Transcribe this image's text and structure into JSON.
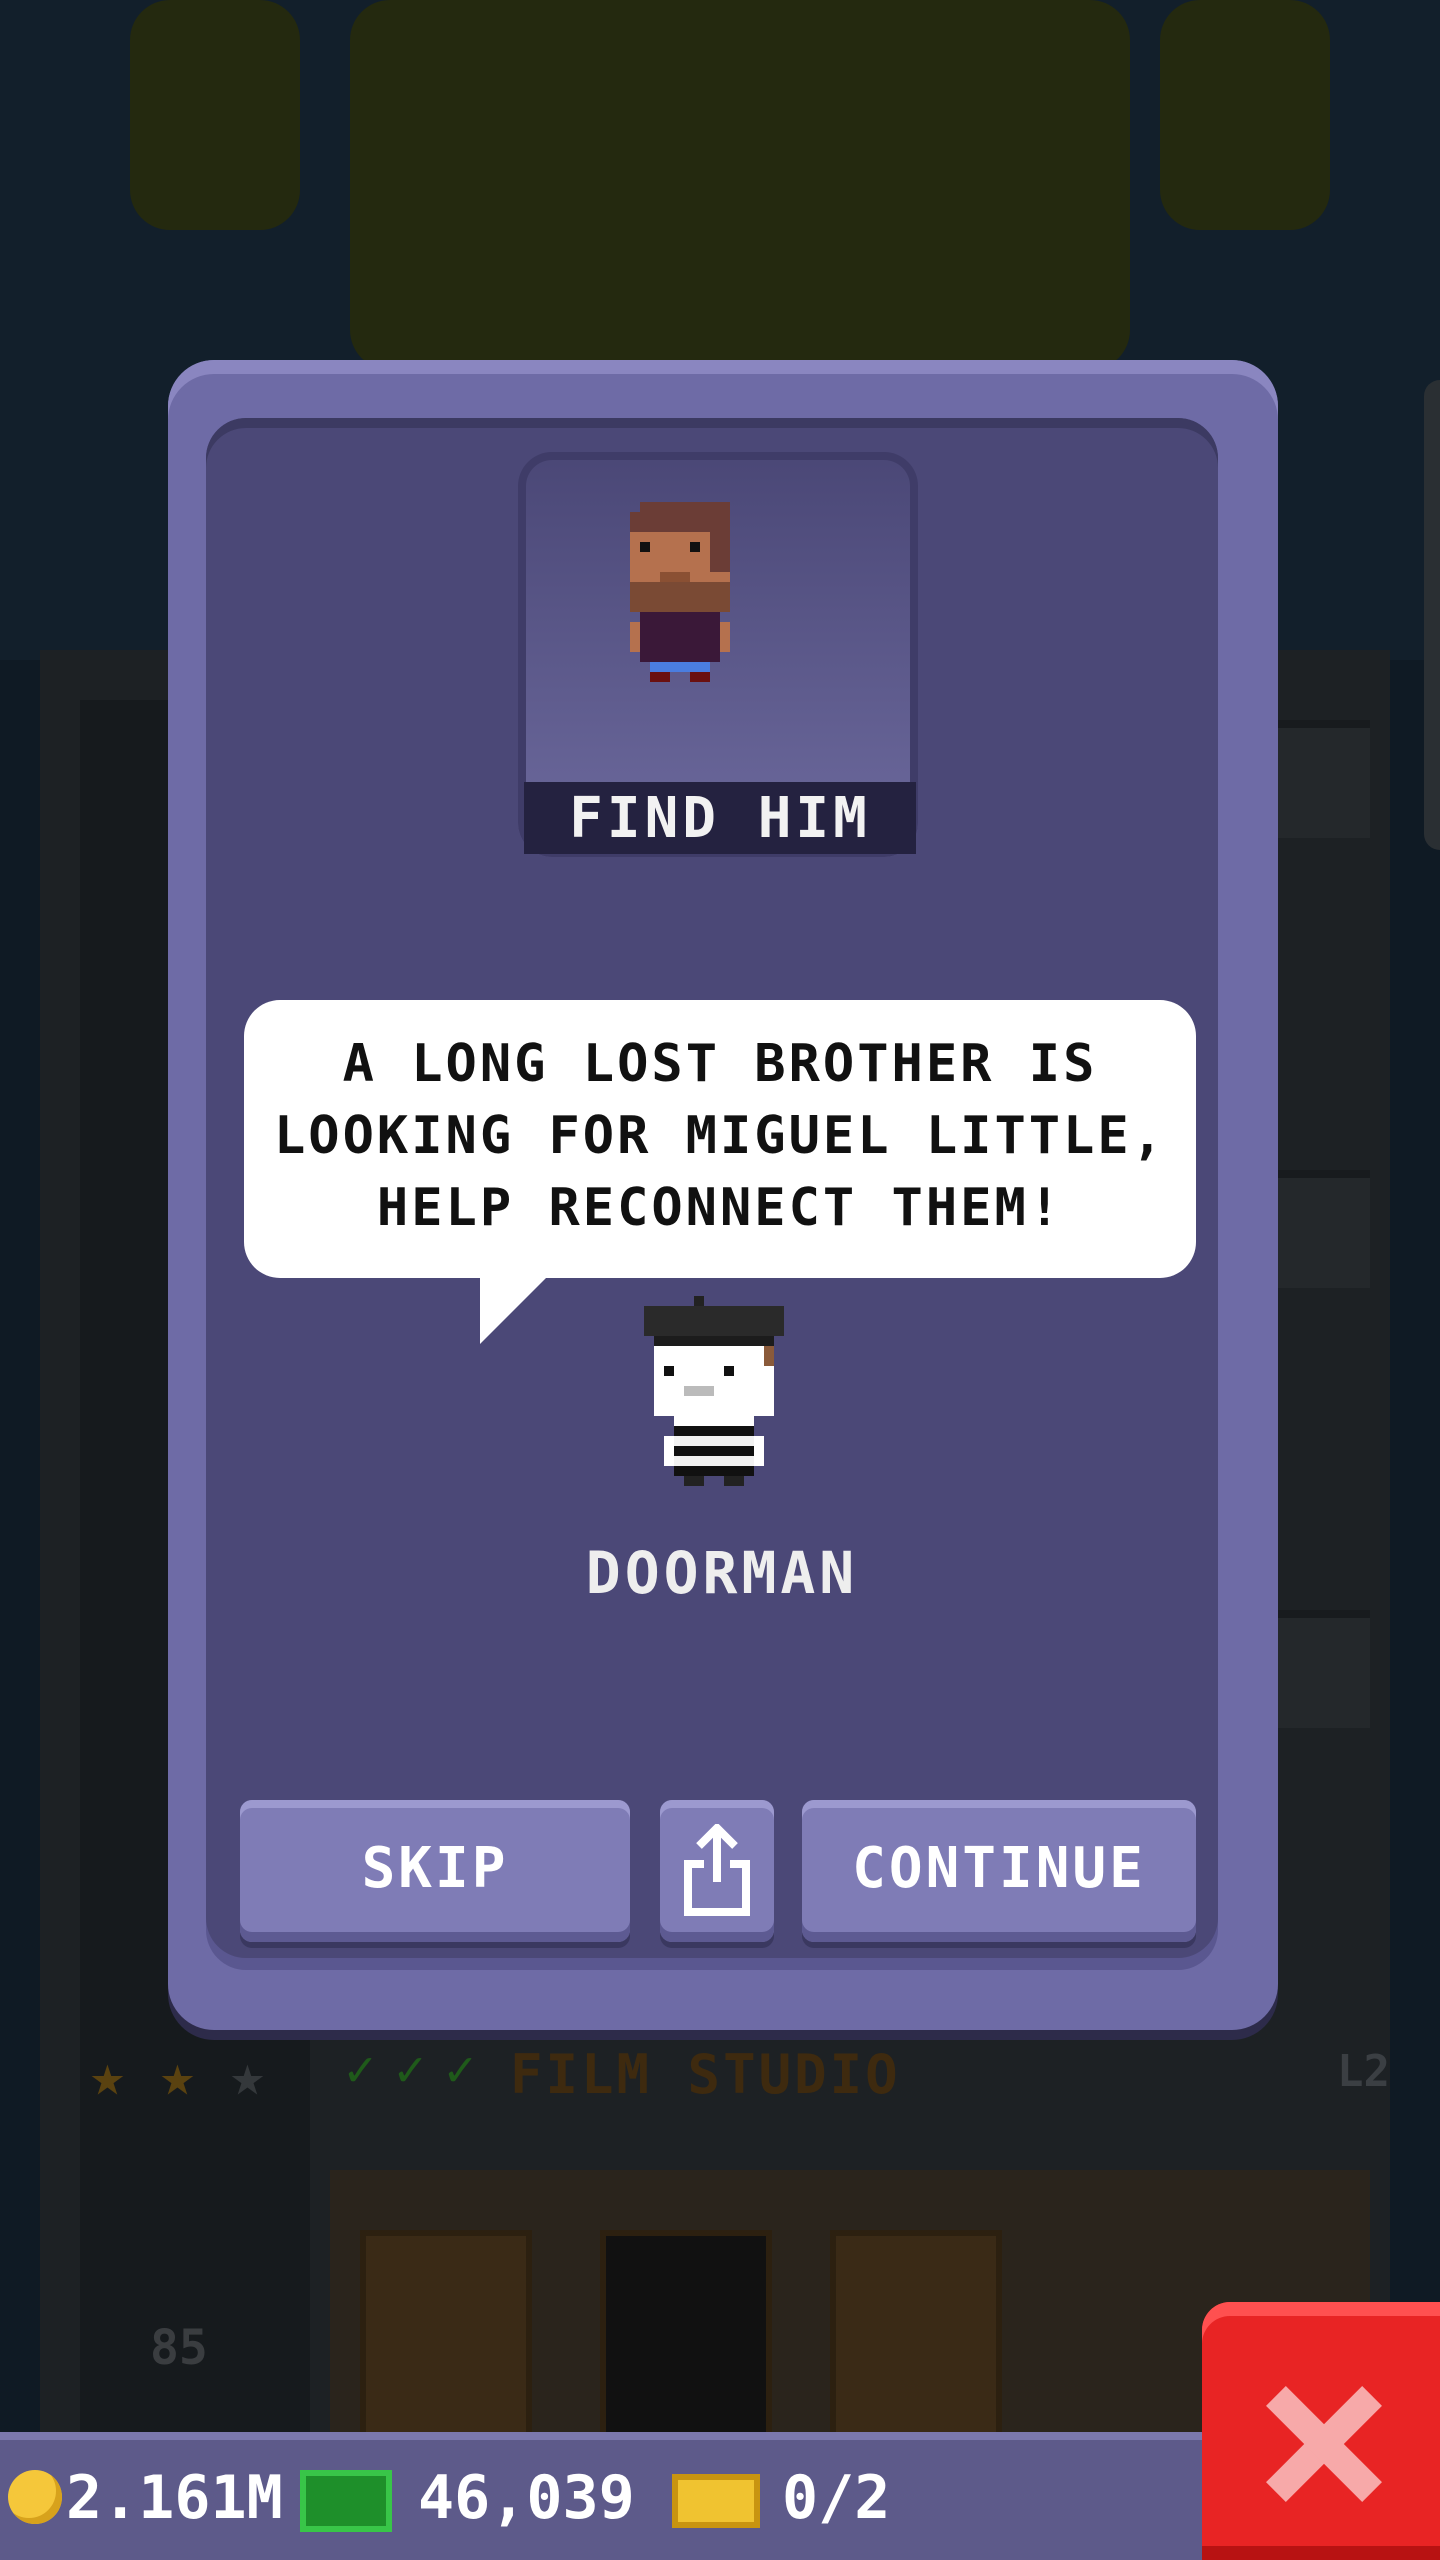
{
  "dialog": {
    "portrait_label": "FIND HIM",
    "speech_lines": [
      "A LONG LOST BROTHER IS",
      "LOOKING FOR MIGUEL LITTLE,",
      "HELP RECONNECT THEM!"
    ],
    "speaker_name": "DOORMAN",
    "buttons": {
      "skip_label": "SKIP",
      "share_icon": "share-icon",
      "continue_label": "CONTINUE"
    }
  },
  "background": {
    "floor_label": "FILM STUDIO",
    "floor_level": "L2",
    "floor_number": "85",
    "stars_filled": 2,
    "stars_total": 3
  },
  "status_bar": {
    "coins": "2.161M",
    "bux": "46,039",
    "tickets": "0/2",
    "icons": [
      "coin-icon",
      "bux-icon",
      "golden-ticket-icon",
      "close-icon"
    ]
  },
  "colors": {
    "dialog_frame": "#6e6ba6",
    "dialog_inner": "#4b4877",
    "button": "#7f7cb6",
    "close_button": "#e82424"
  }
}
